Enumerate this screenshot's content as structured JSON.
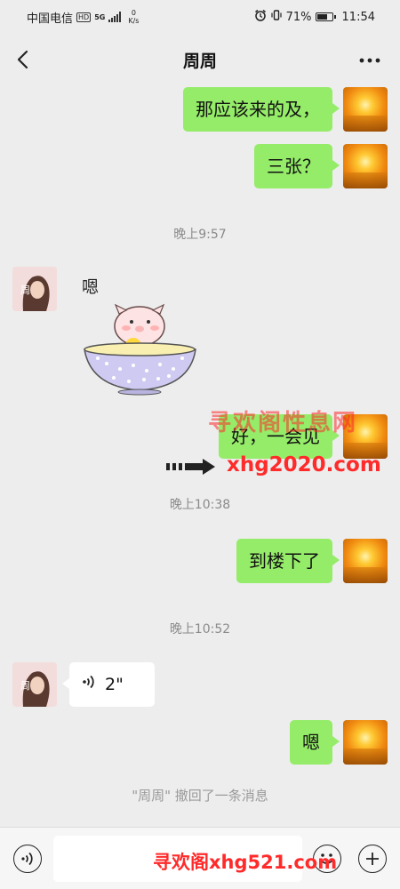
{
  "status_bar": {
    "carrier": "中国电信",
    "hd_badge": "HD",
    "network_type": "5G",
    "net_speed_value": "0",
    "net_speed_unit": "K/s",
    "battery_percent": "71%",
    "battery_level": 0.71,
    "time": "11:54"
  },
  "nav": {
    "title": "周周",
    "back_icon": "chevron-left-icon",
    "more_icon": "more-dots-icon"
  },
  "contact": {
    "avatar_label": "周"
  },
  "messages": [
    {
      "from": "self",
      "text": "那应该来的及，"
    },
    {
      "from": "self",
      "text": "三张？"
    },
    {
      "type": "timestamp",
      "text": "晚上9:57"
    },
    {
      "from": "other",
      "type": "sticker",
      "caption": "嗯"
    },
    {
      "from": "self",
      "text": "好，一会见"
    },
    {
      "type": "timestamp",
      "text": "晚上10:38"
    },
    {
      "from": "self",
      "text": "到楼下了"
    },
    {
      "type": "timestamp",
      "text": "晚上10:52"
    },
    {
      "from": "other",
      "type": "voice",
      "duration": "2\""
    },
    {
      "from": "self",
      "text": "嗯"
    },
    {
      "type": "system",
      "text": "\"周周\" 撤回了一条消息"
    }
  ],
  "watermarks": {
    "top": "寻欢阁性息网",
    "middle": "xhg2020.com",
    "bottom": "寻欢阁xhg521.com"
  },
  "input_bar": {
    "text_value": "",
    "voice_icon": "voice-input-icon",
    "emoji_icon": "emoji-icon",
    "plus_icon": "plus-icon"
  },
  "colors": {
    "self_bubble": "#95ec69",
    "other_bubble": "#ffffff",
    "background": "#ededed",
    "watermark": "#ff2a2a"
  }
}
